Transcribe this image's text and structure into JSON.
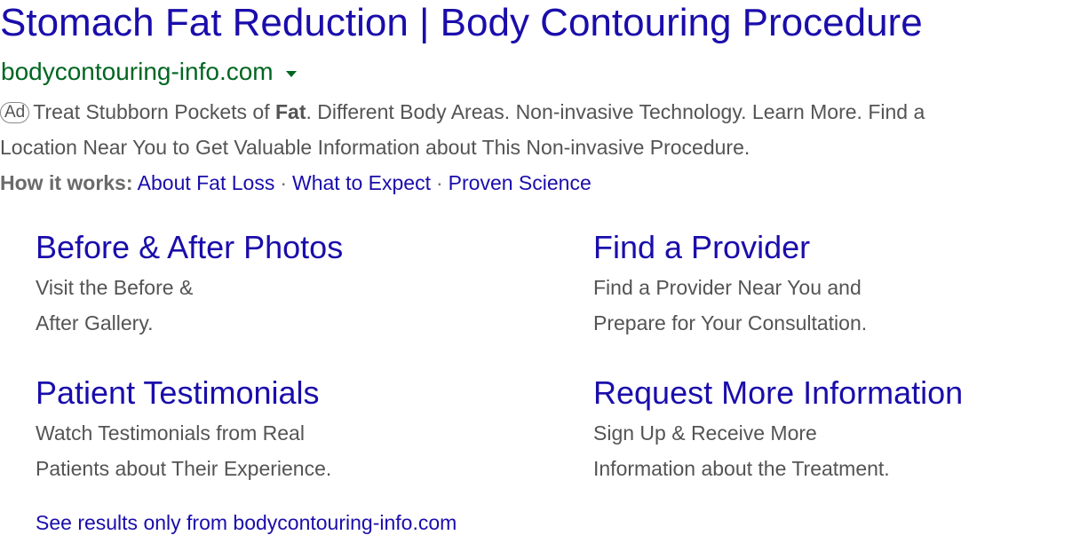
{
  "ad": {
    "title": "Stomach Fat Reduction | Body Contouring Procedure",
    "display_url": "bodycontouring-info.com",
    "caret_icon": "dropdown-caret-icon",
    "badge": "Ad",
    "description": {
      "part1": "Treat Stubborn Pockets of ",
      "bold": "Fat",
      "part2": ". Different Body Areas. Non-invasive Technology. Learn More. Find a",
      "line2": "Location Near You to Get Valuable Information about This Non-invasive Procedure."
    },
    "how_it_works": {
      "label": "How it works:",
      "links": [
        "About Fat Loss",
        "What to Expect",
        "Proven Science"
      ],
      "separator": "·"
    }
  },
  "sitelinks": [
    {
      "title": "Before & After Photos",
      "lines": [
        "Visit the Before &",
        "After Gallery."
      ]
    },
    {
      "title": "Find a Provider",
      "lines": [
        "Find a Provider Near You and",
        "Prepare for Your Consultation."
      ]
    },
    {
      "title": "Patient Testimonials",
      "lines": [
        "Watch Testimonials from Real",
        "Patients about Their Experience."
      ]
    },
    {
      "title": "Request More Information",
      "lines": [
        "Sign Up & Receive More",
        "Information about the Treatment."
      ]
    }
  ],
  "see_results": "See results only from bodycontouring-info.com",
  "colors": {
    "link": "#1a0dab",
    "url": "#006621",
    "text": "#545454"
  }
}
